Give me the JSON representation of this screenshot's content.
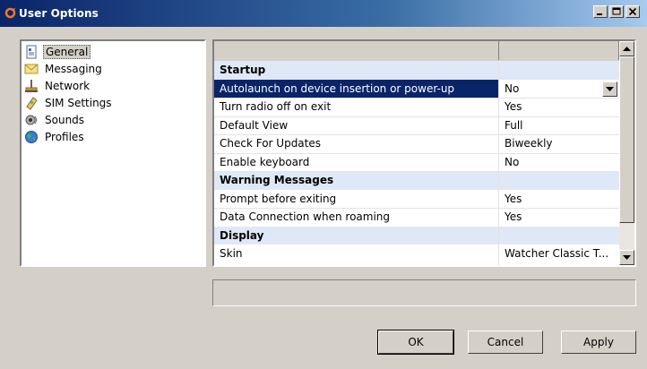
{
  "window": {
    "title": "User Options"
  },
  "nav": {
    "items": [
      {
        "label": "General",
        "icon": "general-icon",
        "selected": true
      },
      {
        "label": "Messaging",
        "icon": "envelope-icon"
      },
      {
        "label": "Network",
        "icon": "network-icon"
      },
      {
        "label": "SIM Settings",
        "icon": "sim-card-icon"
      },
      {
        "label": "Sounds",
        "icon": "speaker-icon"
      },
      {
        "label": "Profiles",
        "icon": "globe-icon"
      }
    ]
  },
  "grid": {
    "rows": [
      {
        "type": "category",
        "label": "Startup"
      },
      {
        "type": "item",
        "label": "Autolaunch on device insertion or power-up",
        "value": "No",
        "selected": true
      },
      {
        "type": "item",
        "label": "Turn radio off on exit",
        "value": "Yes"
      },
      {
        "type": "item",
        "label": "Default View",
        "value": "Full"
      },
      {
        "type": "item",
        "label": "Check For Updates",
        "value": "Biweekly"
      },
      {
        "type": "item",
        "label": "Enable keyboard",
        "value": "No"
      },
      {
        "type": "category",
        "label": "Warning Messages"
      },
      {
        "type": "item",
        "label": "Prompt before exiting",
        "value": "Yes"
      },
      {
        "type": "item",
        "label": "Data Connection when roaming",
        "value": "Yes"
      },
      {
        "type": "category",
        "label": "Display"
      },
      {
        "type": "item",
        "label": "Skin",
        "value": "Watcher Classic T..."
      }
    ]
  },
  "buttons": {
    "ok": "OK",
    "cancel": "Cancel",
    "apply": "Apply"
  },
  "colors": {
    "selection": "#0a246a",
    "category_bg": "#dfe8f6",
    "window_bg": "#d4d0c8",
    "title_start": "#0a246a",
    "app_icon": "#f07820"
  }
}
